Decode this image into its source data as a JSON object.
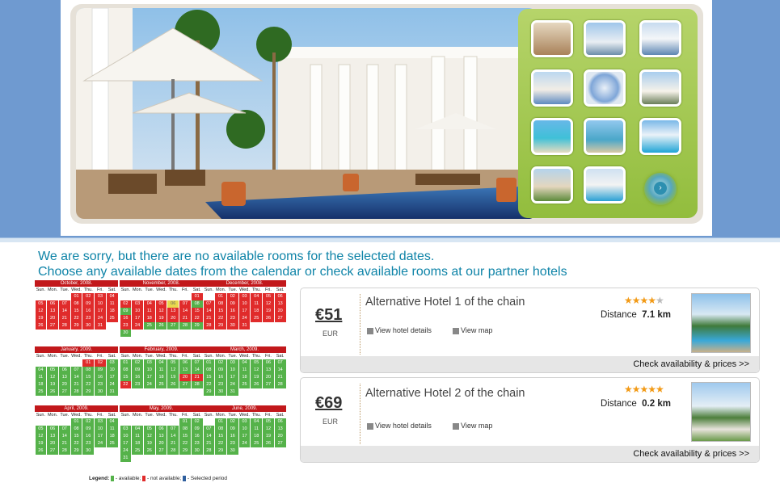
{
  "messages": {
    "line1": "We are sorry, but there are no available rooms for the selected dates.",
    "line2": "Choose any available dates from the calendar or check available rooms at our partner hotels"
  },
  "gallery": {
    "thumbnails": [
      "room-thumb",
      "tower-thumb",
      "bridge-thumb",
      "highrise-thumb",
      "lifebuoy-thumb",
      "palm-building-thumb",
      "beach-thumb",
      "bay-thumb",
      "resort-pool-thumb",
      "villa-thumb",
      "pool-deck-thumb"
    ],
    "next_icon": "chevron-right-icon"
  },
  "calendar": {
    "dow": [
      "Sun.",
      "Mon.",
      "Tue.",
      "Wed.",
      "Thu.",
      "Fri.",
      "Sat."
    ],
    "months": [
      {
        "name": "October, 2008.",
        "offset": 3,
        "days": 31,
        "colors": "rrrrrrrrrrrrrrrrrrrrrrrrrrrrrrr"
      },
      {
        "name": "November, 2008.",
        "offset": 6,
        "days": 30,
        "colors": "rrrrrrrggrrrrrrrrrrrrrrrggggggg"
      },
      {
        "name": "December, 2008.",
        "offset": 1,
        "days": 31,
        "colors": "rrrrrrrrrrrrrrrrrrrrrrrrrrrrrrr"
      },
      {
        "name": "January, 2009.",
        "offset": 4,
        "days": 31,
        "colors": "rrgggggggggggggggggggggggggggggg"
      },
      {
        "name": "February, 2009.",
        "offset": 0,
        "days": 28,
        "colors": "gggggggggggggggggggrrrgggggg"
      },
      {
        "name": "March, 2009.",
        "offset": 0,
        "days": 31,
        "colors": "ggggggggggggggggggggggggggggggg"
      },
      {
        "name": "April, 2009.",
        "offset": 3,
        "days": 30,
        "colors": "gggggggggggggggggggggggggggggg"
      },
      {
        "name": "May, 2009.",
        "offset": 5,
        "days": 31,
        "colors": "ggggggggggggggggggggggggggggggg"
      },
      {
        "name": "June, 2009.",
        "offset": 1,
        "days": 30,
        "colors": "gggggggggggggggggggggggggggggg"
      }
    ],
    "highlight": {
      "month_index": 1,
      "day": 6
    },
    "legend": {
      "title": "Legend",
      "available": "- available;",
      "not_available": "- not available;",
      "selected": "- Selected period"
    },
    "colors": {
      "available": "#55b24a",
      "not_available": "#e02b2b",
      "selected": "#2f5f9e"
    }
  },
  "hotels": [
    {
      "price": "€51",
      "currency": "EUR",
      "name": "Alternative Hotel 1 of the chain",
      "stars": 4,
      "distance_label": "Distance",
      "distance": "7.1 km",
      "details_link": "View hotel details",
      "map_link": "View map",
      "cta": "Check availability & prices >>"
    },
    {
      "price": "€69",
      "currency": "EUR",
      "name": "Alternative Hotel 2 of the chain",
      "stars": 5,
      "distance_label": "Distance",
      "distance": "0.2 km",
      "details_link": "View hotel details",
      "map_link": "View map",
      "cta": "Check availability & prices >>"
    }
  ]
}
